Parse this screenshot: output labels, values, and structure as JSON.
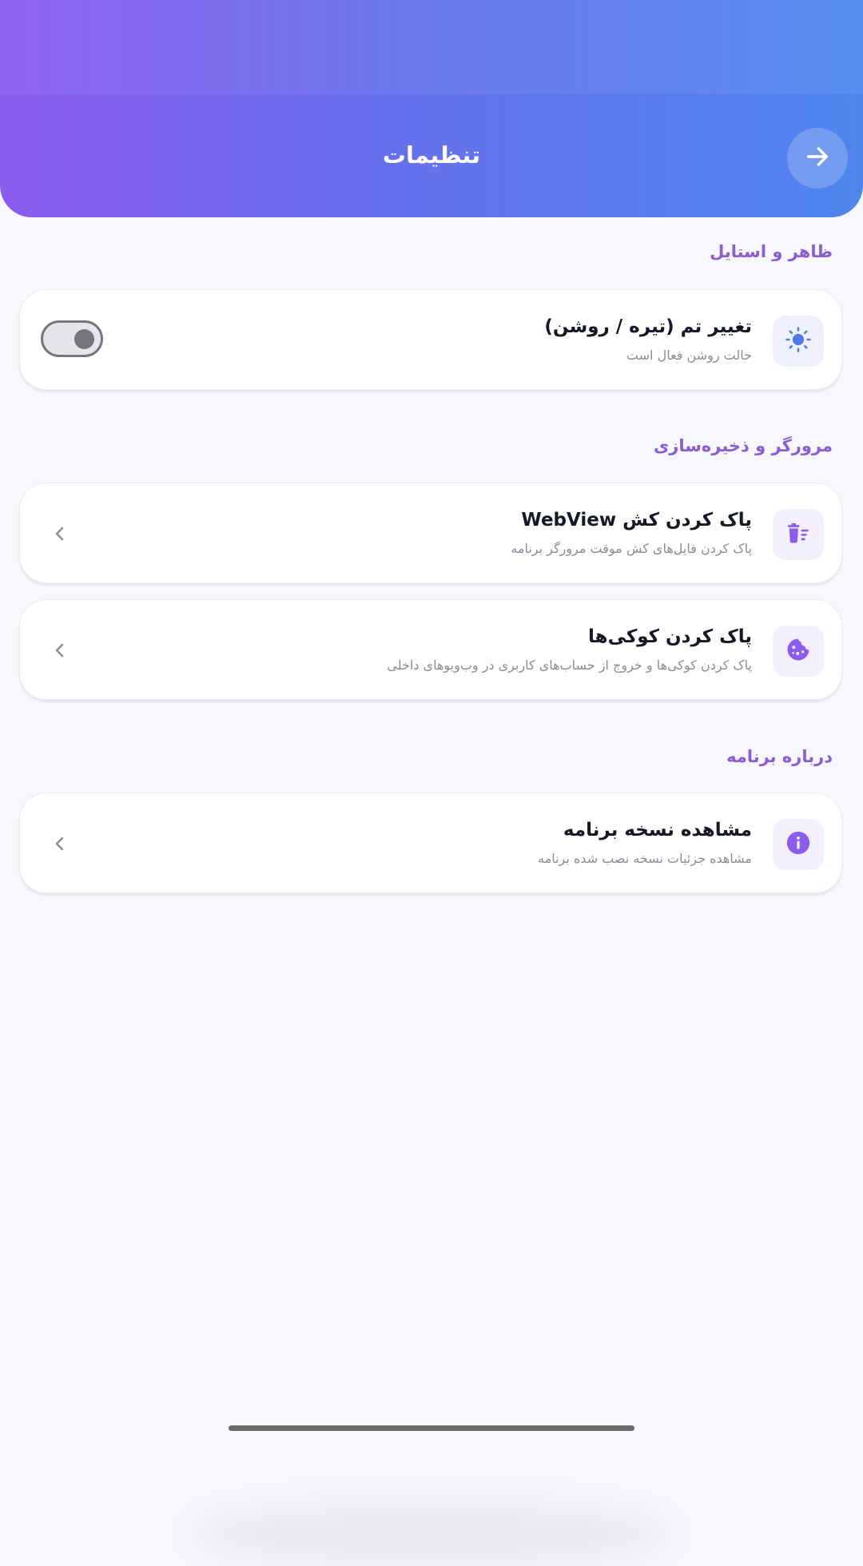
{
  "header": {
    "title": "تنظیمات",
    "back_icon": "arrow-right-icon"
  },
  "sections": {
    "appearance": {
      "title": "ظاهر و استایل",
      "theme": {
        "title": "تغییر تم (تیره / روشن)",
        "subtitle": "حالت روشن فعال است",
        "icon": "sun-icon",
        "toggle_on": false
      }
    },
    "browser": {
      "title": "مرورگر و ذخیره‌سازی",
      "cache": {
        "title": "پاک کردن کش WebView",
        "subtitle": "پاک کردن فایل‌های کش موقت مرورگر برنامه",
        "icon": "trash-list-icon"
      },
      "cookies": {
        "title": "پاک کردن کوکی‌ها",
        "subtitle": "پاک کردن کوکی‌ها و خروج از حساب‌های کاربری در وب‌ویوهای داخلی",
        "icon": "cookie-icon"
      }
    },
    "about": {
      "title": "درباره برنامه",
      "version": {
        "title": "مشاهده نسخه برنامه",
        "subtitle": "مشاهده جزئیات نسخه نصب شده برنامه",
        "icon": "info-icon"
      }
    }
  },
  "colors": {
    "accent": "#8a5cd6",
    "header_start": "#8b5cf0",
    "header_end": "#4f86ee",
    "sun": "#4f7be8"
  }
}
